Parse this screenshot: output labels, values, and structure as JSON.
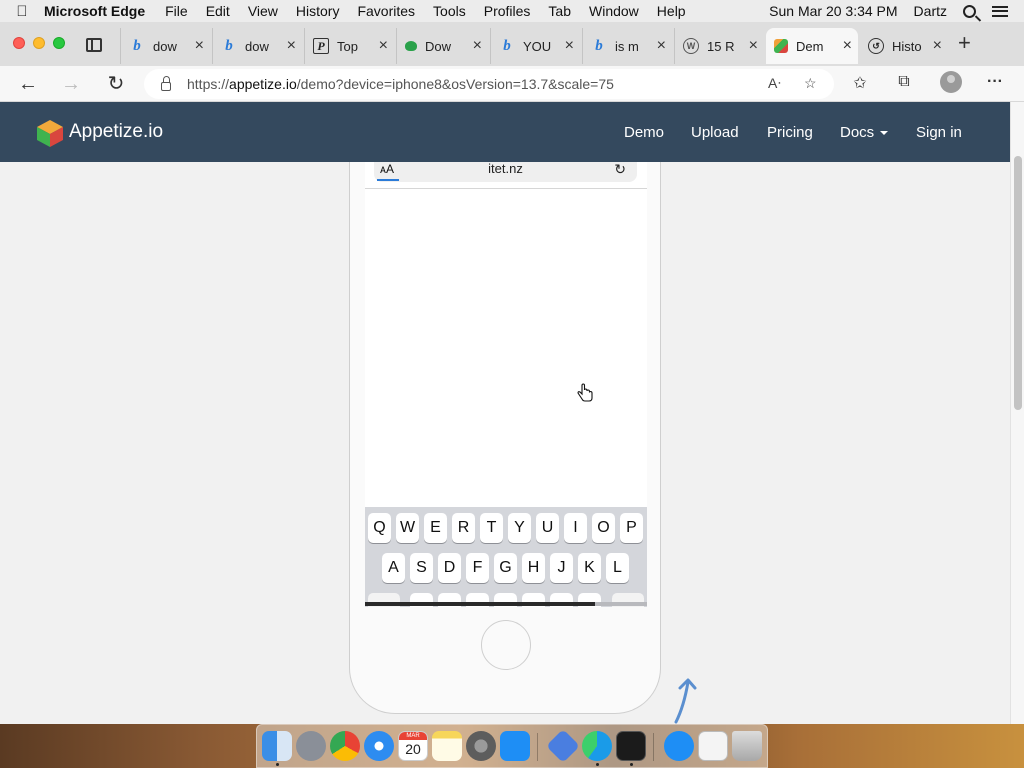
{
  "menubar": {
    "app_name": "Microsoft Edge",
    "menus": [
      "File",
      "Edit",
      "View",
      "History",
      "Favorites",
      "Tools",
      "Profiles",
      "Tab",
      "Window",
      "Help"
    ],
    "clock": "Sun Mar 20  3:34 PM",
    "user": "Dartz"
  },
  "tabs": [
    {
      "title": "dow",
      "favicon": "bing-icon"
    },
    {
      "title": "dow",
      "favicon": "bing-icon"
    },
    {
      "title": "Top",
      "favicon": "p-icon"
    },
    {
      "title": "Dow",
      "favicon": "leaf-icon"
    },
    {
      "title": "YOU",
      "favicon": "bing-icon"
    },
    {
      "title": "is m",
      "favicon": "bing-icon"
    },
    {
      "title": "15 R",
      "favicon": "wordpress-icon"
    },
    {
      "title": "Dem",
      "favicon": "appetize-cube-icon",
      "active": true
    },
    {
      "title": "Histo",
      "favicon": "history-icon"
    }
  ],
  "address_bar": {
    "url_prefix": "https://",
    "url_host": "appetize.io",
    "url_path": "/demo?device=iphone8&osVersion=13.7&scale=75"
  },
  "site_nav": {
    "brand": "Appetize.io",
    "links": [
      "Demo",
      "Upload",
      "Pricing",
      "Docs",
      "Sign in"
    ]
  },
  "phone": {
    "safari": {
      "text_size_label": "ᴀA",
      "host": "itet.nz"
    },
    "keyboard": {
      "row1": [
        "Q",
        "W",
        "E",
        "R",
        "T",
        "Y",
        "U",
        "I",
        "O",
        "P"
      ],
      "row2": [
        "A",
        "S",
        "D",
        "F",
        "G",
        "H",
        "J",
        "K",
        "L"
      ]
    }
  },
  "dock": {
    "apps": [
      "finder-icon",
      "launchpad-icon",
      "chrome-icon",
      "safari-icon",
      "calendar-icon",
      "notes-icon",
      "system-preferences-icon",
      "app-store-icon",
      "visual-studio-icon",
      "edge-icon",
      "terminal-icon",
      "app-store-downloads-icon",
      "document-icon",
      "trash-icon"
    ],
    "calendar_month": "MAR",
    "calendar_day": "20"
  },
  "colors": {
    "site_navbar": "#34495e",
    "edge_blue": "#2b7bd8"
  }
}
